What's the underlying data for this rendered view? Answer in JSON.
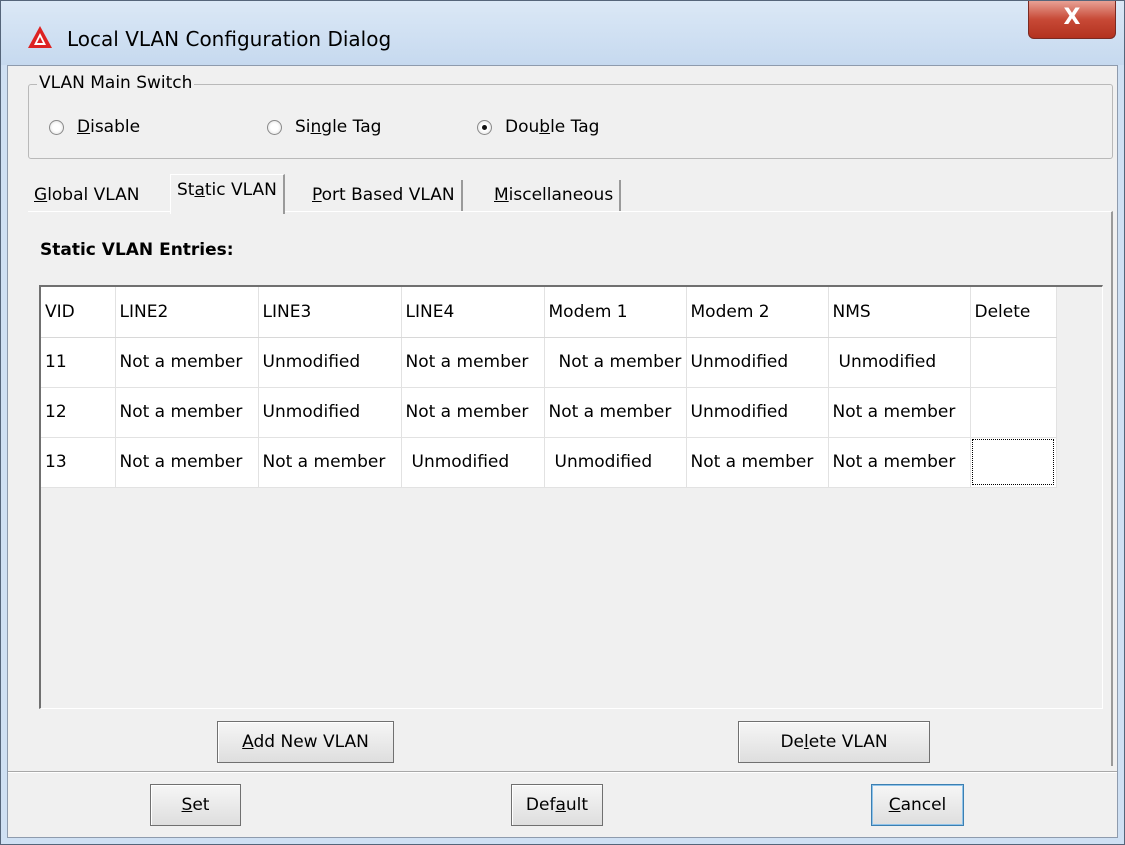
{
  "window": {
    "title": "Local VLAN Configuration Dialog",
    "close_label": "X"
  },
  "vlan_main_switch": {
    "legend": "VLAN Main Switch",
    "options": [
      {
        "pre": "",
        "accel": "D",
        "post": "isable",
        "checked": false
      },
      {
        "pre": "Si",
        "accel": "n",
        "post": "gle Tag",
        "checked": false
      },
      {
        "pre": "Dou",
        "accel": "b",
        "post": "le Tag",
        "checked": true
      }
    ]
  },
  "tabs": [
    {
      "pre": "",
      "accel": "G",
      "post": "lobal VLAN",
      "active": false
    },
    {
      "pre": "St",
      "accel": "a",
      "post": "tic VLAN",
      "active": true
    },
    {
      "pre": "",
      "accel": "P",
      "post": "ort Based VLAN",
      "active": false
    },
    {
      "pre": "",
      "accel": "M",
      "post": "iscellaneous",
      "active": false
    }
  ],
  "static_vlan": {
    "section_title": "Static VLAN Entries:",
    "columns": [
      "VID",
      "LINE2",
      "LINE3",
      "LINE4",
      "Modem 1",
      "Modem 2",
      "NMS",
      "Delete"
    ],
    "rows": [
      [
        "11",
        "Not a member",
        "Unmodified",
        "Not a member",
        "Not a member",
        "Unmodified",
        "Unmodified",
        ""
      ],
      [
        "12",
        "Not a member",
        "Unmodified",
        "Not a member",
        "Not a member",
        "Unmodified",
        "Not a member",
        ""
      ],
      [
        "13",
        "Not a member",
        "Not a member",
        "Unmodified",
        "Unmodified",
        "Not a member",
        "Not a member",
        ""
      ]
    ],
    "add_button": {
      "pre": "",
      "accel": "A",
      "post": "dd New VLAN"
    },
    "delete_button": {
      "pre": "De",
      "accel": "l",
      "post": "ete VLAN"
    }
  },
  "footer": {
    "set_button": {
      "pre": "",
      "accel": "S",
      "post": "et"
    },
    "default_button": {
      "pre": "Def",
      "accel": "a",
      "post": "ult"
    },
    "cancel_button": {
      "pre": "",
      "accel": "C",
      "post": "ancel"
    }
  }
}
